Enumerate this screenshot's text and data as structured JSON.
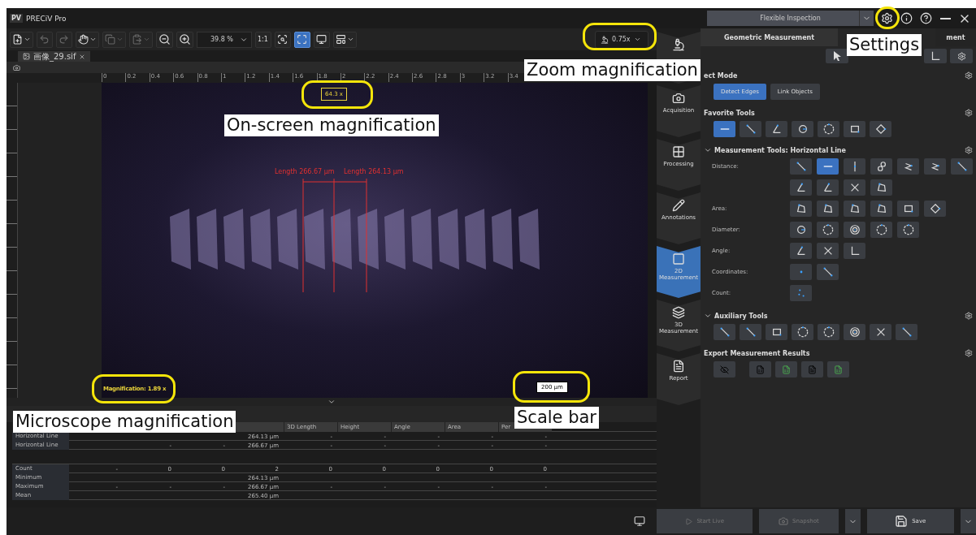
{
  "window": {
    "logo": "PV",
    "title": "PRECiV Pro",
    "workspace": "Flexible Inspection"
  },
  "toolbar": {
    "history": [
      {
        "disabled": true
      },
      {
        "disabled": true
      }
    ],
    "zoom": "39.8 %",
    "view_buttons": [
      {
        "label": "1:1",
        "selected": false
      },
      {
        "selected": false
      },
      {
        "selected": true
      },
      {
        "selected": false
      }
    ],
    "zoom_magnification": "0.75x"
  },
  "document_tab": {
    "title": "画像_29.sif"
  },
  "ruler": {
    "labels": [
      "0",
      "0.2",
      "0.4",
      "0.6",
      "0.8",
      "1",
      "1.2",
      "1.4",
      "1.6",
      "1.8",
      "2",
      "2.2",
      "2.4",
      "2.6",
      "2.8",
      "3",
      "3.2",
      "3.4"
    ]
  },
  "image": {
    "onscreen_magnification": "64.3 x",
    "measurements": [
      "Length 266.67 µm",
      "Length 264.13 µm"
    ],
    "microscope_magnification": "Magnification: 1.89 x",
    "scale_bar": "200 µm"
  },
  "callouts": [
    {
      "text": "Zoom magnification"
    },
    {
      "text": "On-screen magnification"
    },
    {
      "text": "Microscope magnification"
    },
    {
      "text": "Scale bar"
    },
    {
      "text": "Settings"
    }
  ],
  "results": {
    "columns": [
      "3D Length",
      "Height",
      "Angle",
      "Area",
      "Per"
    ],
    "rows": [
      {
        "name": "Horizontal Line",
        "cells": [
          null,
          null,
          null,
          "264.13 µm",
          "-",
          "-",
          "-",
          "-",
          "-"
        ]
      },
      {
        "name": "Horizontal Line",
        "cells": [
          null,
          "-",
          "-",
          "266.67 µm",
          "-",
          "-",
          "-",
          "-",
          "-"
        ]
      }
    ],
    "stats": [
      {
        "name": "Count",
        "cells": [
          "-",
          "0",
          "0",
          "2",
          "0",
          "0",
          "0",
          "0",
          "0"
        ]
      },
      {
        "name": "Minimum",
        "cells": [
          null,
          null,
          null,
          "264.13 µm",
          null,
          null,
          null,
          null,
          null
        ]
      },
      {
        "name": "Maximum",
        "cells": [
          "-",
          "-",
          "-",
          "266.67 µm",
          "-",
          "-",
          "-",
          "-",
          "-"
        ]
      },
      {
        "name": "Mean",
        "cells": [
          null,
          null,
          null,
          "265.40 µm",
          null,
          null,
          null,
          null,
          null
        ]
      }
    ]
  },
  "nav": [
    {
      "selected": false
    },
    {
      "label": "Acquisition",
      "selected": false
    },
    {
      "label": "Processing",
      "selected": false
    },
    {
      "label": "Annotations",
      "selected": false
    },
    {
      "label": "2D Measurement",
      "selected": true
    },
    {
      "label": "3D Measurement",
      "selected": false
    },
    {
      "label": "Report",
      "selected": false
    }
  ],
  "panel": {
    "tabs": [
      {
        "label": "Geometric Measurement",
        "selected": true
      },
      {
        "label": "ment",
        "selected": false
      }
    ],
    "select_mode": {
      "title": "ect Mode",
      "buttons": [
        {
          "label": "Detect Edges",
          "selected": true
        },
        {
          "label": "Link Objects",
          "selected": false
        }
      ]
    },
    "favorite_tools": {
      "title": "Favorite Tools",
      "tools": [
        {
          "selected": true
        },
        {
          "selected": false
        },
        {
          "selected": false
        },
        {
          "selected": false
        },
        {
          "selected": false
        },
        {
          "selected": false
        },
        {
          "selected": false
        }
      ]
    },
    "measurement_tools": {
      "title": "Measurement Tools: Horizontal Line",
      "expanded": true,
      "groups": [
        {
          "label": "Distance:",
          "tools": [
            {
              "selected": false
            },
            {
              "selected": true
            },
            {
              "selected": false
            },
            {
              "selected": false
            },
            {
              "selected": false
            },
            {
              "selected": false
            },
            {
              "selected": false
            },
            {
              "selected": false
            },
            {
              "selected": false
            },
            {
              "selected": false
            },
            {
              "selected": false
            }
          ]
        },
        {
          "label": "Area:",
          "tools": [
            {
              "selected": false
            },
            {
              "selected": false
            },
            {
              "selected": false
            },
            {
              "selected": false
            },
            {
              "selected": false
            },
            {
              "selected": false
            }
          ]
        },
        {
          "label": "Diameter:",
          "tools": [
            {
              "selected": false
            },
            {
              "selected": false
            },
            {
              "selected": false
            },
            {
              "selected": false
            },
            {
              "selected": false
            }
          ]
        },
        {
          "label": "Angle:",
          "tools": [
            {
              "selected": false
            },
            {
              "selected": false
            },
            {
              "selected": false
            }
          ]
        },
        {
          "label": "Coordinates:",
          "tools": [
            {
              "selected": false
            },
            {
              "selected": false
            }
          ]
        },
        {
          "label": "Count:",
          "tools": [
            {
              "selected": false
            }
          ]
        }
      ]
    },
    "auxiliary_tools": {
      "title": "Auxiliary Tools",
      "expanded": true,
      "tools": [
        {
          "selected": false
        },
        {
          "selected": false
        },
        {
          "selected": false
        },
        {
          "selected": false
        },
        {
          "selected": false
        },
        {
          "selected": false
        },
        {
          "selected": false
        },
        {
          "selected": false
        }
      ]
    },
    "export": {
      "title": "Export Measurement Results"
    }
  },
  "actions": [
    {
      "label": "Start Live",
      "disabled": true
    },
    {
      "label": "Snapshot",
      "disabled": true
    },
    {
      "label": "Save",
      "disabled": false
    }
  ]
}
